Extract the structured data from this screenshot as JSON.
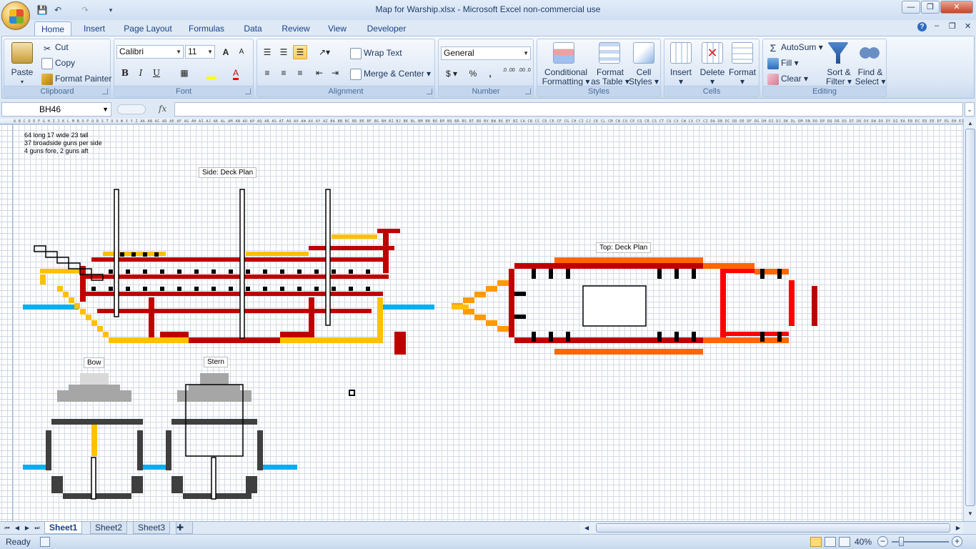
{
  "window": {
    "title": "Map for Warship.xlsx - Microsoft Excel non-commercial use",
    "minimize": "—",
    "maximize": "❐",
    "close": "✕"
  },
  "tabs": [
    "Home",
    "Insert",
    "Page Layout",
    "Formulas",
    "Data",
    "Review",
    "View",
    "Developer"
  ],
  "ribbon": {
    "clipboard": {
      "paste": "Paste",
      "cut": "Cut",
      "copy": "Copy",
      "format_painter": "Format Painter",
      "label": "Clipboard"
    },
    "font": {
      "name": "Calibri",
      "size": "11",
      "bold": "B",
      "italic": "I",
      "underline": "U",
      "grow": "A",
      "shrink": "A",
      "label": "Font"
    },
    "alignment": {
      "wrap_text": "Wrap Text",
      "merge_center": "Merge & Center",
      "label": "Alignment"
    },
    "number": {
      "format": "General",
      "currency": "$",
      "percent": "%",
      "comma": ",",
      "inc_decimal": ".0 .00",
      "dec_decimal": ".00 .0",
      "label": "Number"
    },
    "styles": {
      "conditional": "Conditional",
      "conditional2": "Formatting",
      "format_table": "Format",
      "format_table2": "as Table",
      "cell_styles": "Cell",
      "cell_styles2": "Styles",
      "label": "Styles"
    },
    "cells": {
      "insert": "Insert",
      "delete": "Delete",
      "format": "Format",
      "label": "Cells"
    },
    "editing": {
      "autosum": "AutoSum",
      "fill": "Fill",
      "clear": "Clear",
      "sort": "Sort &",
      "sort2": "Filter",
      "find": "Find &",
      "find2": "Select",
      "label": "Editing"
    }
  },
  "formula_bar": {
    "name_box": "BH46",
    "fx": "fx",
    "value": ""
  },
  "sheet": {
    "notes": [
      "64 long 17 wide 23 tall",
      "37 broadside guns per side",
      "4 guns fore, 2 guns aft"
    ],
    "labels": {
      "side": "Side: Deck Plan",
      "top": "Top: Deck Plan",
      "bow": "Bow",
      "stern": "Stern"
    },
    "column_headers": "A B C D E F G H I J K L M N O P Q R S T U V W X Y Z AA AB AC AD AE AF AG AH AI AJ AK AL AM AN AO AP AQ AR AS AT AU AV AW AX AY AZ BA BB BC BD BE BF BG BH BI BJ BK BL BM BN BO BP BQ BR BS BT BU BV BW BX BY BZ CA CB CC CD CE CF CG CH CI CJ CK CL CM CN CO CP CQ CR CS CT CU CV CW CX CY CZ DA DB DC DD DE DF DG DH DI DJ DK DL DM DN DO DP DQ DR DS DT DU DV DW DX DY DZ EA EB EC ED EE EF EG EH EI EJ EK EL EM EN EO EP EQ ER ES ET EU EV EW EX EY EZ FA FB FC FD FE FF FG FH FI FJ FK"
  },
  "sheet_tabs": [
    "Sheet1",
    "Sheet2",
    "Sheet3"
  ],
  "status": {
    "ready": "Ready",
    "zoom": "40%"
  },
  "colors": {
    "dark_red": "#c00000",
    "red": "#ff0000",
    "orange": "#ff6600",
    "amber": "#ff9900",
    "yellow": "#ffc000",
    "blue": "#00b0f0",
    "black": "#000000",
    "dark_gray": "#3f3f3f",
    "gray": "#a6a6a6",
    "light_gray": "#d9d9d9"
  }
}
